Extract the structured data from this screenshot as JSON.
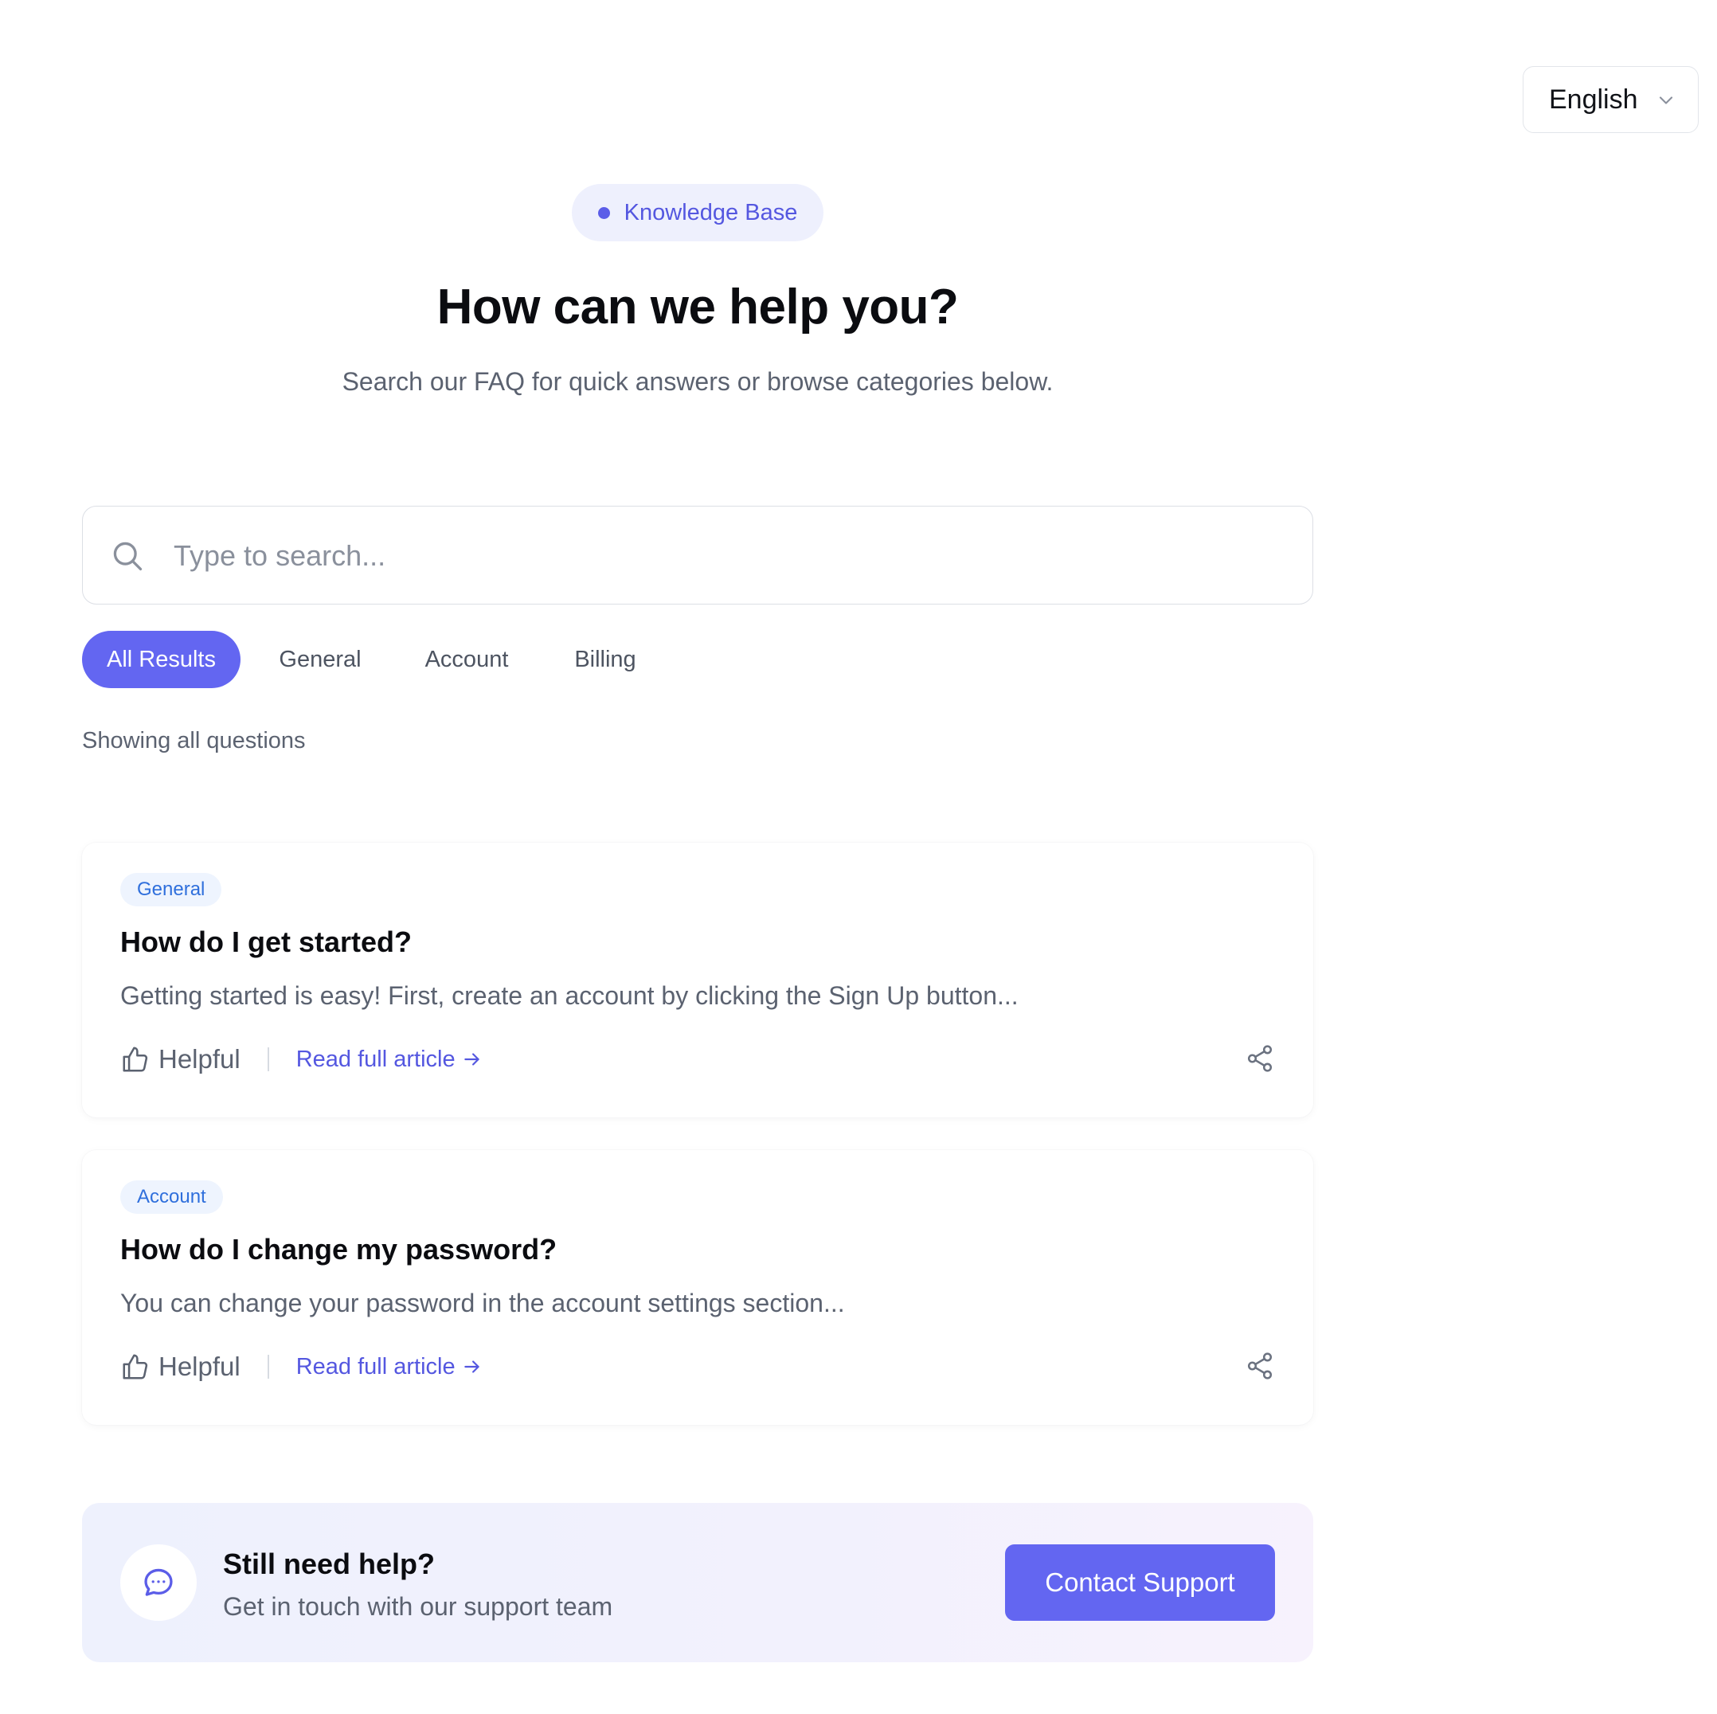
{
  "language": {
    "selected": "English",
    "icon": "chevron-down-icon"
  },
  "hero": {
    "badge": "Knowledge Base",
    "title": "How can we help you?",
    "subtitle": "Search our FAQ for quick answers or browse categories below."
  },
  "search": {
    "placeholder": "Type to search...",
    "value": "",
    "icon": "search-icon"
  },
  "tabs": [
    {
      "label": "All Results",
      "active": true
    },
    {
      "label": "General",
      "active": false
    },
    {
      "label": "Account",
      "active": false
    },
    {
      "label": "Billing",
      "active": false
    }
  ],
  "results_status": "Showing all questions",
  "faqs": [
    {
      "category": "General",
      "title": "How do I get started?",
      "excerpt": "Getting started is easy! First, create an account by clicking the Sign Up button...",
      "helpful_label": "Helpful",
      "read_label": "Read full article",
      "icons": [
        "thumbs-up-icon",
        "arrow-right-icon",
        "share-icon"
      ]
    },
    {
      "category": "Account",
      "title": "How do I change my password?",
      "excerpt": "You can change your password in the account settings section...",
      "helpful_label": "Helpful",
      "read_label": "Read full article",
      "icons": [
        "thumbs-up-icon",
        "arrow-right-icon",
        "share-icon"
      ]
    }
  ],
  "support": {
    "title": "Still need help?",
    "subtitle": "Get in touch with our support team",
    "button_label": "Contact Support",
    "icon": "chat-bubble-icon"
  },
  "colors": {
    "accent": "#6366f1",
    "accent_text": "#5457e0",
    "chip_bg": "#eef4fe",
    "chip_text": "#2f6fdc",
    "muted_text": "#5b6270"
  }
}
